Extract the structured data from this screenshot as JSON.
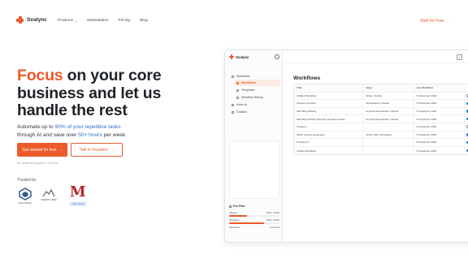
{
  "nav": {
    "brand": "Svalync",
    "links": [
      {
        "label": "Products",
        "has_dropdown": true
      },
      {
        "label": "Marketplace",
        "has_dropdown": false
      },
      {
        "label": "Pricing",
        "has_dropdown": false
      },
      {
        "label": "Blog",
        "has_dropdown": false
      }
    ],
    "cta": "Start for Free",
    "cta_arrow": "→"
  },
  "hero": {
    "title_accent": "Focus",
    "title_rest_1": " on your core",
    "title_line_2": "business and let us",
    "title_line_3": "handle the rest",
    "sub_1": "Automate up to ",
    "sub_highlight_1": "90% of your repetitive tasks",
    "sub_2": "through AI and save over ",
    "sub_highlight_2": "50+ hours",
    "sub_3": " per week.",
    "primary_button": "Get started for free",
    "primary_arrow": "→",
    "secondary_button": "Talk to founders",
    "secondary_arrow": "→",
    "note": "No credit card required. Free plan.",
    "trusted_by": "Trusted by",
    "partners": [
      {
        "name": "RecordGuru"
      },
      {
        "name": "TERRIN TREK"
      },
      {
        "name": "M",
        "badge": "Case Study"
      }
    ]
  },
  "app": {
    "brand": "Svalync",
    "sidebar": {
      "items": [
        {
          "label": "Workflows",
          "active": false,
          "caret": "⌄",
          "indent": false
        },
        {
          "label": "Workflows",
          "active": true,
          "caret": "",
          "indent": true
        },
        {
          "label": "Templates",
          "active": false,
          "caret": "",
          "indent": true
        },
        {
          "label": "Workflow History",
          "active": false,
          "caret": "",
          "indent": true
        },
        {
          "label": "Voice AI",
          "active": false,
          "caret": "⌄",
          "indent": false
        },
        {
          "label": "Chatbot",
          "active": false,
          "caret": "⌄",
          "indent": false
        }
      ]
    },
    "plan": {
      "title": "Pro Plan",
      "rows": [
        {
          "label": "Classes",
          "value": "3500 / 10000",
          "fraction": 0.35
        },
        {
          "label": "Messages",
          "value": "7000 / 10000",
          "fraction": 0.7
        },
        {
          "label": "Workflows",
          "value": "Unlimited",
          "fraction": null
        }
      ]
    },
    "close_glyph": "×",
    "heading": "Workflows",
    "table": {
      "columns": [
        "Title",
        "Apps",
        "Last Modified",
        ""
      ],
      "rows": [
        {
          "title": "Untitled Workflow",
          "apps": "Stripe, Testing",
          "modified": "6 November 2023",
          "enabled": false
        },
        {
          "title": "Session Gecoder",
          "apps": "Zip Extractor, Claude",
          "modified": "6 November 2023",
          "enabled": true
        },
        {
          "title": "SEO Blog Writing",
          "apps": "Keyword Researcher, Claude",
          "modified": "6 November 2023",
          "enabled": true
        },
        {
          "title": "SEO Blog Writing through competitor words",
          "apps": "Keyword Researcher, Claude",
          "modified": "6 November 2023",
          "enabled": true
        },
        {
          "title": "Testing 2",
          "apps": "",
          "modified": "6 November 2023",
          "enabled": false
        },
        {
          "title": "Stripe Invoice Generation",
          "apps": "Stripe, PDF Generation",
          "modified": "6 November 2023",
          "enabled": true
        },
        {
          "title": "Testing xyz",
          "apps": "",
          "modified": "6 November 2023",
          "enabled": true
        },
        {
          "title": "Untitled Workflow",
          "apps": "",
          "modified": "6 November 2023",
          "enabled": true
        }
      ]
    }
  },
  "colors": {
    "brand_orange": "#ea5a2b",
    "highlight_blue": "#2c6fd1",
    "toggle_blue": "#2f6fd1"
  }
}
